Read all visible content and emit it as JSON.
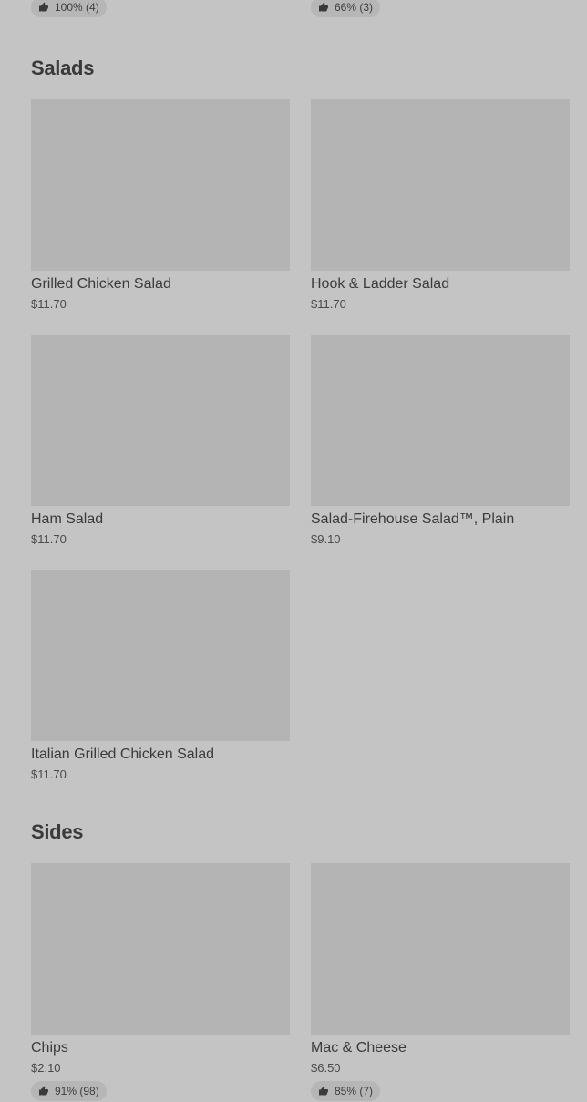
{
  "top_ratings": [
    {
      "text": "100% (4)"
    },
    {
      "text": "66% (3)"
    }
  ],
  "sections": [
    {
      "title": "Salads",
      "items": [
        {
          "name": "Grilled Chicken Salad",
          "price": "$11.70"
        },
        {
          "name": "Hook & Ladder Salad",
          "price": "$11.70"
        },
        {
          "name": "Ham Salad",
          "price": "$11.70"
        },
        {
          "name": "Salad-Firehouse Salad™, Plain",
          "price": "$9.10"
        },
        {
          "name": "Italian Grilled Chicken Salad",
          "price": "$11.70"
        }
      ]
    },
    {
      "title": "Sides",
      "items": [
        {
          "name": "Chips",
          "price": "$2.10",
          "rating": "91% (98)"
        },
        {
          "name": "Mac & Cheese",
          "price": "$6.50",
          "rating": "85% (7)"
        }
      ]
    }
  ],
  "icons": {
    "rating": "thumbs-up-icon"
  },
  "colors": {
    "background": "#c4c4c4",
    "placeholder": "#b4b4b4",
    "badge": "#b6b6b6"
  }
}
